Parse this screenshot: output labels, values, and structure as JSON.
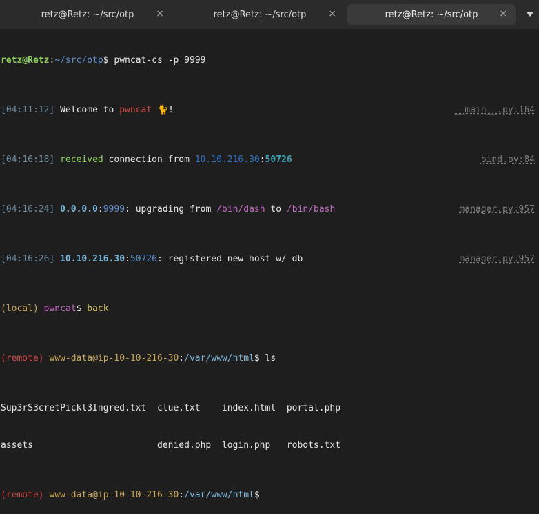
{
  "tabs": [
    {
      "title": "retz@Retz: ~/src/otp",
      "close": "×"
    },
    {
      "title": "retz@Retz: ~/src/otp",
      "close": "×"
    },
    {
      "title": "retz@Retz: ~/src/otp",
      "close": "×"
    }
  ],
  "terminal": {
    "l1": {
      "user": "retz@Retz",
      "colon": ":",
      "path": "~/src/otp",
      "sign": "$ ",
      "cmd": "pwncat-cs -p 9999"
    },
    "l2": {
      "ts": "[04:11:12]",
      "pre": " Welcome to ",
      "app": "pwncat",
      "post": " 🐈!",
      "src": "__main__.py:164"
    },
    "l3": {
      "ts": "[04:16:18]",
      "word": " received",
      "pre": " connection from ",
      "ip": "10.10.216.30",
      "colon": ":",
      "port": "50726",
      "src": "bind.py:84"
    },
    "l4": {
      "ts": "[04:16:24]",
      "ip": " 0.0.0.0",
      "colon": ":",
      "port": "9999",
      "pre": ": upgrading from ",
      "from": "/bin/dash",
      "mid": " to ",
      "to": "/bin/bash",
      "src": "manager.py:957"
    },
    "l5": {
      "ts": "[04:16:26]",
      "ip": " 10.10.216.30",
      "colon": ":",
      "port": "50726",
      "post": ": registered new host w/ db",
      "src": "manager.py:957"
    },
    "l6": {
      "ctx": "(local)",
      "sp": " ",
      "app": "pwncat",
      "sign": "$ ",
      "cmd": "back"
    },
    "l7": {
      "ctx": "(remote)",
      "sp": " ",
      "user": "www-data@ip-10-10-216-30",
      "colon": ":",
      "path": "/var/www/html",
      "sign": "$ ",
      "cmd": "ls"
    },
    "l8": "Sup3rS3cretPickl3Ingred.txt  clue.txt    index.html  portal.php",
    "l9": "assets                       denied.php  login.php   robots.txt",
    "l10": {
      "ctx": "(remote)",
      "sp": " ",
      "user": "www-data@ip-10-10-216-30",
      "colon": ":",
      "path": "/var/www/html",
      "sign": "$"
    }
  },
  "icons": {
    "dropdown": "chevron-down-icon"
  }
}
